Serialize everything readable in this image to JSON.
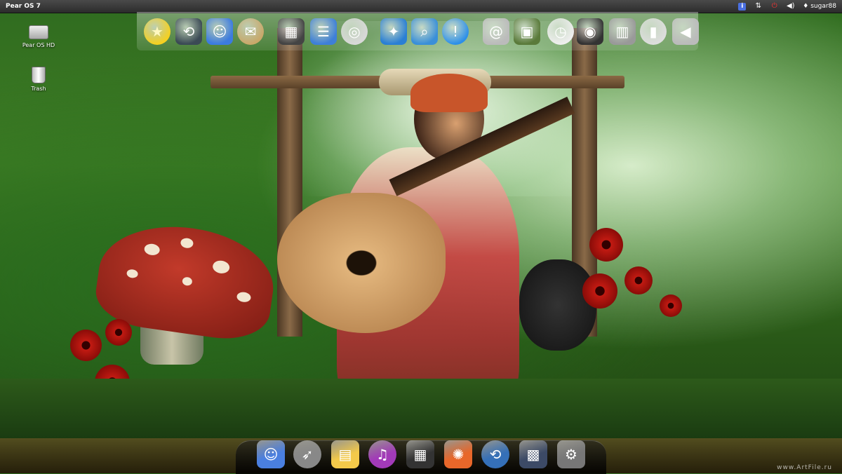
{
  "menubar": {
    "app_name": "Pear OS 7",
    "username": "sugar88"
  },
  "desktop_icons": [
    {
      "label": "Pear OS HD",
      "icon": "hard-drive-icon"
    },
    {
      "label": "Trash",
      "icon": "trash-icon"
    }
  ],
  "top_dock": [
    {
      "icon": "star-icon",
      "glyph": "★",
      "color": "#f5d020"
    },
    {
      "icon": "time-machine-icon",
      "glyph": "⟲",
      "color": "#3b4a55"
    },
    {
      "icon": "finder-icon",
      "glyph": "☺",
      "color": "#3c7be0"
    },
    {
      "icon": "mail-stamp-icon",
      "glyph": "✉",
      "color": "#c9a86a"
    },
    {
      "icon": "calculator-icon",
      "glyph": "▦",
      "color": "#444444"
    },
    {
      "icon": "document-icon",
      "glyph": "☰",
      "color": "#3e7fd8"
    },
    {
      "icon": "dvd-icon",
      "glyph": "◎",
      "color": "#d8d8d8"
    },
    {
      "icon": "safari-icon",
      "glyph": "✦",
      "color": "#2a7fd4"
    },
    {
      "icon": "preview-icon",
      "glyph": "⌕",
      "color": "#3a8fd8"
    },
    {
      "icon": "help-icon",
      "glyph": "!",
      "color": "#2d8fe8"
    },
    {
      "icon": "address-book-icon",
      "glyph": "@",
      "color": "#bbbbbb"
    },
    {
      "icon": "photo-icon",
      "glyph": "▣",
      "color": "#5a7a3a"
    },
    {
      "icon": "clock-icon",
      "glyph": "◷",
      "color": "#eeeeee"
    },
    {
      "icon": "dashboard-icon",
      "glyph": "◉",
      "color": "#333333"
    },
    {
      "icon": "microphone-icon",
      "glyph": "▥",
      "color": "#999999"
    },
    {
      "icon": "switch-icon",
      "glyph": "▮",
      "color": "#dddddd"
    },
    {
      "icon": "speaker-icon",
      "glyph": "◀",
      "color": "#bbbbbb"
    }
  ],
  "bottom_dock": [
    {
      "icon": "finder-icon",
      "glyph": "☺",
      "color": "#4a7fe0"
    },
    {
      "icon": "launchpad-icon",
      "glyph": "➶",
      "color": "#888888"
    },
    {
      "icon": "notes-icon",
      "glyph": "▤",
      "color": "#f3c94a"
    },
    {
      "icon": "itunes-icon",
      "glyph": "♫",
      "color": "#a23ab8"
    },
    {
      "icon": "calculator-icon",
      "glyph": "▦",
      "color": "#333333"
    },
    {
      "icon": "firefox-icon",
      "glyph": "✺",
      "color": "#e8672a"
    },
    {
      "icon": "time-machine-icon",
      "glyph": "⟲",
      "color": "#3570b8"
    },
    {
      "icon": "system-info-icon",
      "glyph": "▩",
      "color": "#3c4a66"
    },
    {
      "icon": "settings-icon",
      "glyph": "⚙",
      "color": "#777777"
    }
  ],
  "watermark": "www.ArtFile.ru",
  "colors": {
    "menubar": "#2b2b2b",
    "dock": "#111111"
  }
}
